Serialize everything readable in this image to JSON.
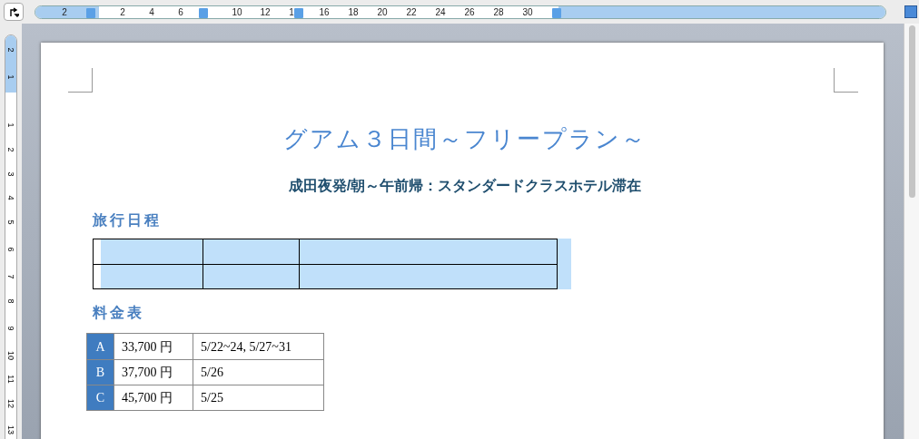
{
  "horizontal_ruler": {
    "labels": [
      "2",
      "2",
      "4",
      "6",
      "10",
      "12",
      "1",
      "16",
      "18",
      "20",
      "22",
      "24",
      "26",
      "28",
      "30"
    ]
  },
  "vertical_ruler": {
    "labels": [
      "2",
      "1",
      "1",
      "2",
      "3",
      "4",
      "5",
      "6",
      "7",
      "8",
      "9",
      "10",
      "11",
      "12",
      "13"
    ]
  },
  "document": {
    "title": "グアム３日間～フリープラン～",
    "subtitle": "成田夜発/朝～午前帰：スタンダードクラスホテル滞在",
    "itinerary_heading": "旅行日程",
    "itinerary_table": {
      "rows": [
        {
          "selected": true
        },
        {
          "selected": true
        }
      ]
    },
    "price_heading": "料金表",
    "price_table": {
      "rows": [
        {
          "class": "A",
          "price": "33,700 円",
          "dates": "5/22~24, 5/27~31"
        },
        {
          "class": "B",
          "price": "37,700 円",
          "dates": "5/26"
        },
        {
          "class": "C",
          "price": "45,700 円",
          "dates": "5/25"
        }
      ]
    }
  }
}
